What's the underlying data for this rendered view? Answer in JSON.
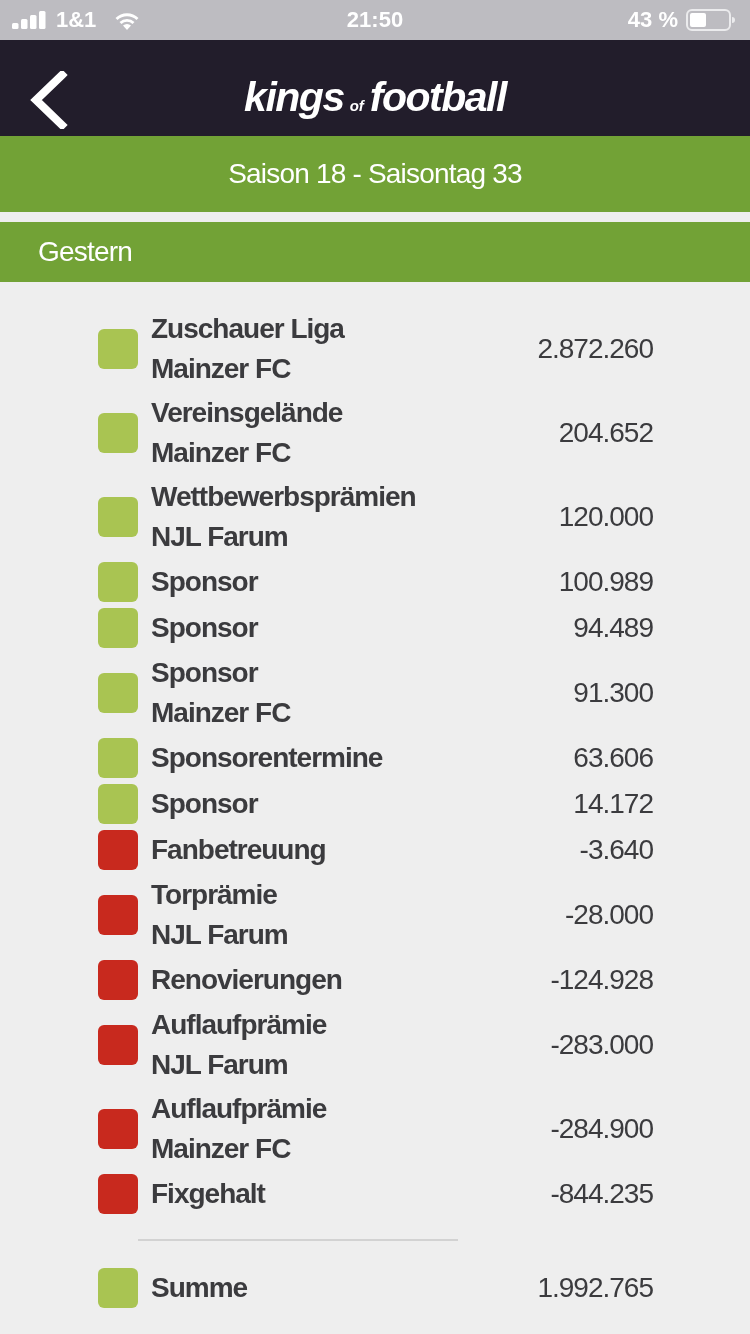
{
  "status_bar": {
    "carrier": "1&1",
    "time": "21:50",
    "battery": "43 %"
  },
  "header": {
    "logo": {
      "first": "kings",
      "small": "of",
      "last": "football"
    }
  },
  "season_bar": {
    "title": "Saison 18 - Saisontag 33"
  },
  "section": {
    "title": "Gestern"
  },
  "rows": [
    {
      "title": "Zuschauer Liga",
      "subtitle": "Mainzer FC",
      "value": "2.872.260",
      "color": "#a9c452"
    },
    {
      "title": "Vereinsgelände",
      "subtitle": "Mainzer FC",
      "value": "204.652",
      "color": "#a9c452"
    },
    {
      "title": "Wettbewerbsprämien",
      "subtitle": "NJL Farum",
      "value": "120.000",
      "color": "#a9c452"
    },
    {
      "title": "Sponsor",
      "value": "100.989",
      "color": "#a9c452"
    },
    {
      "title": "Sponsor",
      "value": "94.489",
      "color": "#a9c452"
    },
    {
      "title": "Sponsor",
      "subtitle": "Mainzer FC",
      "value": "91.300",
      "color": "#a9c452"
    },
    {
      "title": "Sponsorentermine",
      "value": "63.606",
      "color": "#a9c452"
    },
    {
      "title": "Sponsor",
      "value": "14.172",
      "color": "#a9c452"
    },
    {
      "title": "Fanbetreuung",
      "value": "-3.640",
      "color": "#c8291e"
    },
    {
      "title": "Torprämie",
      "subtitle": "NJL Farum",
      "value": "-28.000",
      "color": "#c8291e"
    },
    {
      "title": "Renovierungen",
      "value": "-124.928",
      "color": "#c8291e"
    },
    {
      "title": "Auflaufprämie",
      "subtitle": "NJL Farum",
      "value": "-283.000",
      "color": "#c8291e"
    },
    {
      "title": "Auflaufprämie",
      "subtitle": "Mainzer FC",
      "value": "-284.900",
      "color": "#c8291e"
    },
    {
      "title": "Fixgehalt",
      "value": "-844.235",
      "color": "#c8291e"
    }
  ],
  "summary": {
    "label": "Summe",
    "value": "1.992.765",
    "color": "#a9c452"
  }
}
